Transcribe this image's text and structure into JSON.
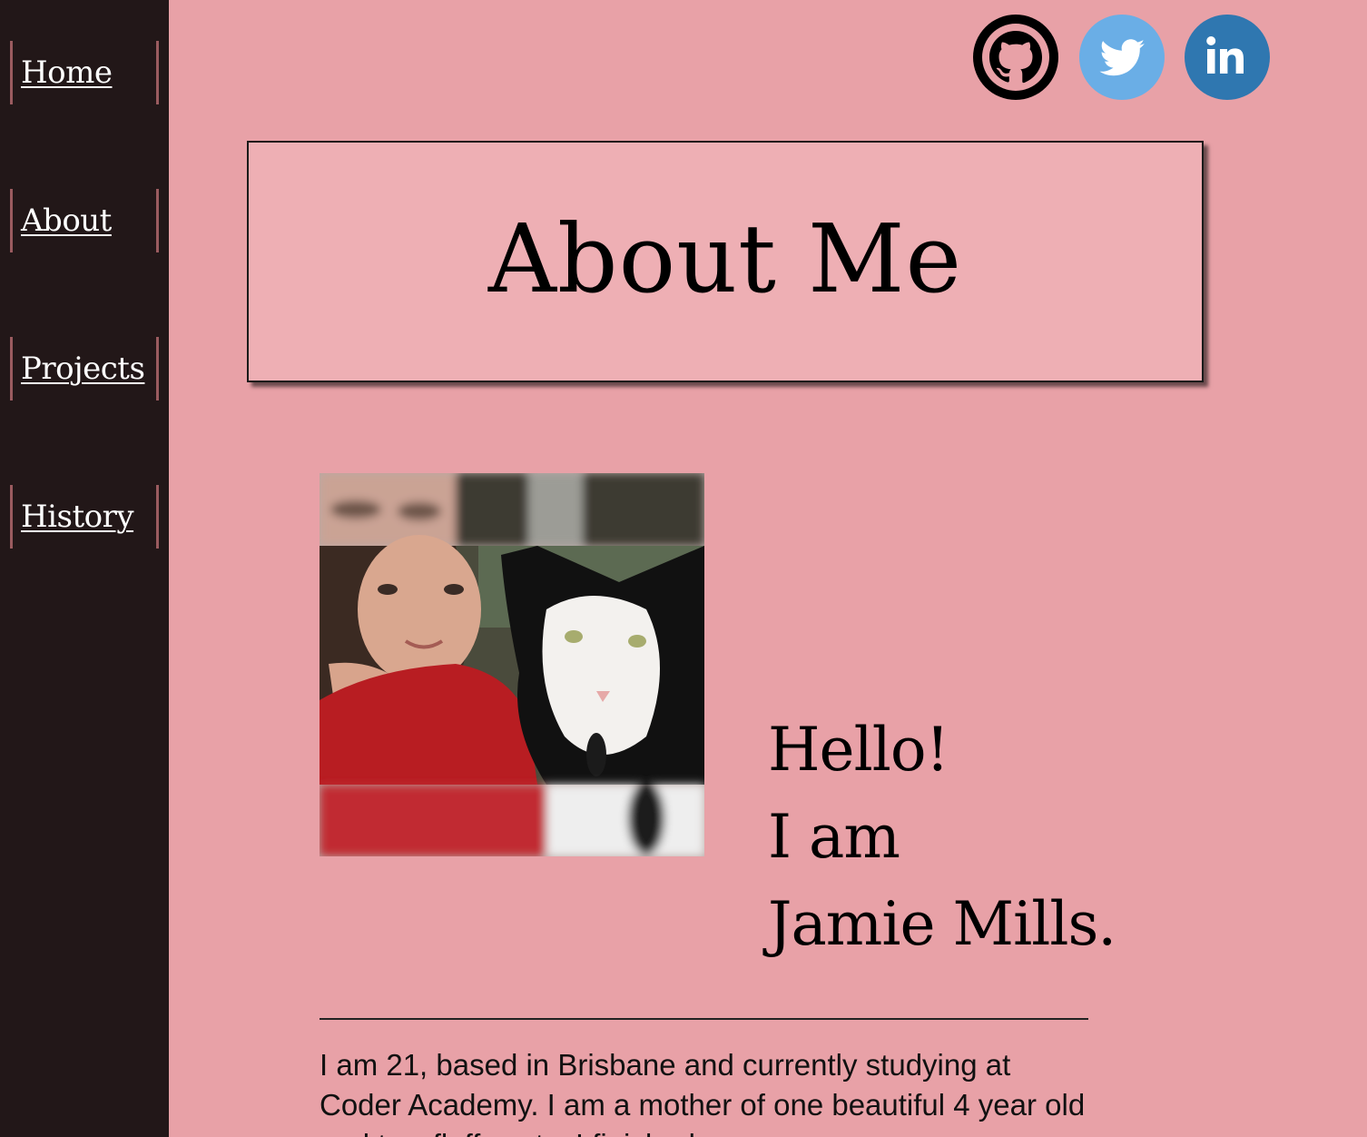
{
  "nav": {
    "items": [
      {
        "label": "Home"
      },
      {
        "label": "About"
      },
      {
        "label": "Projects"
      },
      {
        "label": "History"
      }
    ]
  },
  "social": [
    {
      "icon": "github-icon",
      "color": "#000000"
    },
    {
      "icon": "twitter-icon",
      "color": "#6aaee6"
    },
    {
      "icon": "linkedin-icon",
      "color": "#2f77b0"
    }
  ],
  "header": {
    "title": "About Me"
  },
  "greeting": {
    "line1": "Hello!",
    "line2": "I am",
    "line3": "Jamie Mills."
  },
  "bio": {
    "text": "I am 21, based in Brisbane and currently studying at Coder Academy. I am a mother of one beautiful 4 year old and two fluffy cats. I finished my"
  },
  "colors": {
    "background": "#e8a1a7",
    "sidebar": "#221718",
    "title_box": "#eeafb4"
  }
}
